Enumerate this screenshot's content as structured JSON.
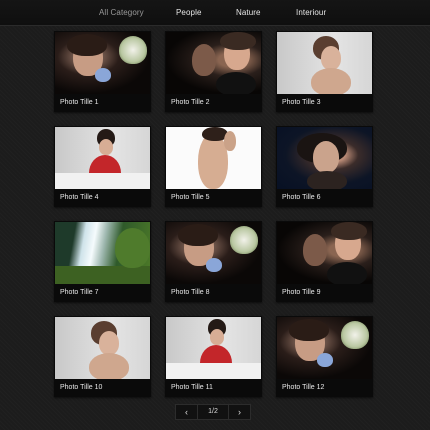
{
  "nav": {
    "items": [
      {
        "label": "All Category"
      },
      {
        "label": "People"
      },
      {
        "label": "Nature"
      },
      {
        "label": "Interiour"
      }
    ]
  },
  "gallery": {
    "items": [
      {
        "caption": "Photo Tille 1",
        "art": "woman-flowers"
      },
      {
        "caption": "Photo Tille 2",
        "art": "two-women"
      },
      {
        "caption": "Photo Tille 3",
        "art": "woman-light"
      },
      {
        "caption": "Photo Tille 4",
        "art": "woman-red-dress"
      },
      {
        "caption": "Photo Tille 5",
        "art": "bare-back"
      },
      {
        "caption": "Photo Tille 6",
        "art": "woman-blue"
      },
      {
        "caption": "Photo Tille 7",
        "art": "waterfall"
      },
      {
        "caption": "Photo Tille 8",
        "art": "woman-flowers"
      },
      {
        "caption": "Photo Tille 9",
        "art": "two-women"
      },
      {
        "caption": "Photo Tille 10",
        "art": "woman-light"
      },
      {
        "caption": "Photo Tille 11",
        "art": "woman-red-dress"
      },
      {
        "caption": "Photo Tille 12",
        "art": "woman-flowers"
      }
    ]
  },
  "pagination": {
    "prev_icon": "chevron-left-icon",
    "next_icon": "chevron-right-icon",
    "page_text": "1/2"
  }
}
